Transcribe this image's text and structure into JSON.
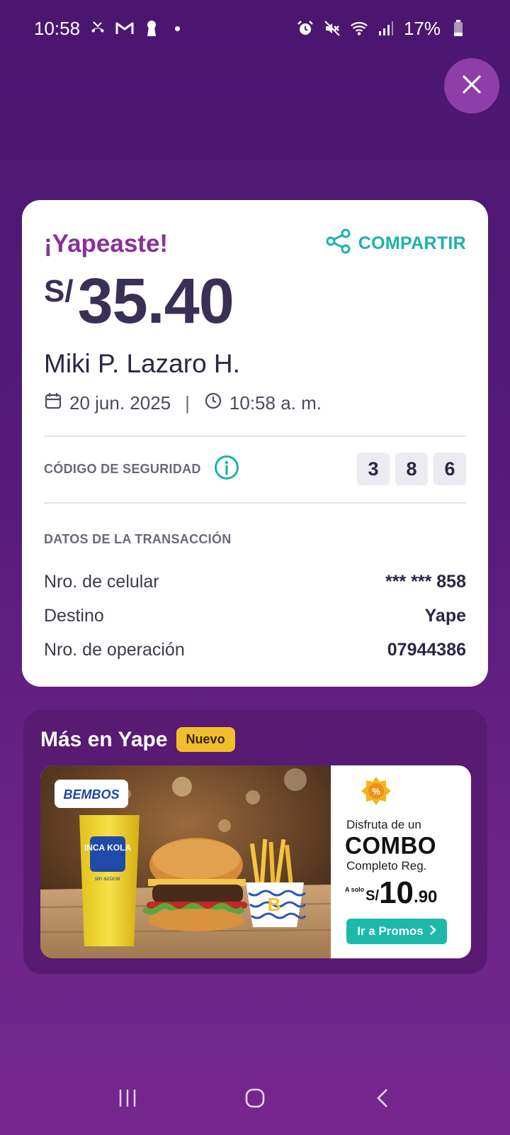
{
  "status_bar": {
    "time": "10:58",
    "battery": "17%"
  },
  "receipt": {
    "title": "¡Yapeaste!",
    "share_label": "COMPARTIR",
    "currency": "S/",
    "amount": "35.40",
    "recipient": "Miki P. Lazaro H.",
    "date": "20 jun. 2025",
    "separator": "|",
    "time": "10:58 a. m.",
    "security_label": "CÓDIGO DE SEGURIDAD",
    "security_code": [
      "3",
      "8",
      "6"
    ],
    "transaction_title": "DATOS DE LA TRANSACCIÓN",
    "rows": [
      {
        "label": "Nro. de celular",
        "value": "*** *** 858"
      },
      {
        "label": "Destino",
        "value": "Yape"
      },
      {
        "label": "Nro. de operación",
        "value": "07944386"
      }
    ]
  },
  "more": {
    "title": "Más en Yape",
    "badge": "Nuevo",
    "promo": {
      "brand_logo": "BEMBOS",
      "drink_logo": "INCA KOLA",
      "drink_sub": "sin azúcar",
      "line1": "Disfruta de un",
      "headline": "COMBO",
      "line3": "Completo Reg.",
      "price_prefix": "A solo",
      "price_currency": "S/",
      "price_int": "10",
      "price_dec": ".90",
      "cta": "Ir a Promos"
    }
  },
  "colors": {
    "accent_purple": "#8a2f9a",
    "accent_teal": "#1bb3a7",
    "background": "#561a78"
  }
}
